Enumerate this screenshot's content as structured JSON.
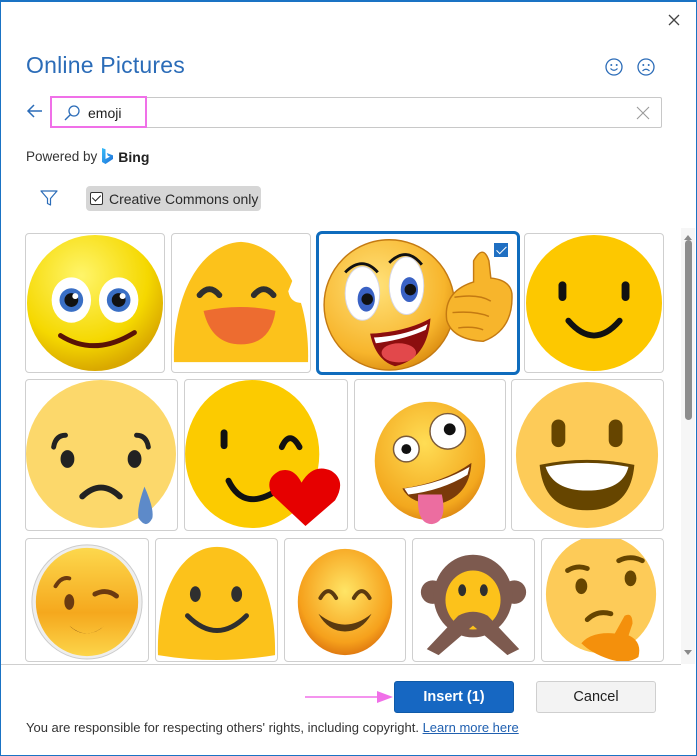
{
  "dialog": {
    "title": "Online Pictures",
    "close_icon": "close-icon",
    "feedback": {
      "smile_icon": "smile-icon",
      "frown_icon": "frown-icon"
    }
  },
  "search": {
    "back_icon": "arrow-left-icon",
    "search_icon": "search-icon",
    "value": "emoji",
    "clear_icon": "close-icon"
  },
  "powered_by": {
    "label": "Powered by",
    "brand": "Bing",
    "brand_icon": "bing-logo-icon"
  },
  "filters": {
    "filter_icon": "filter-icon",
    "creative_commons": {
      "label": "Creative Commons only",
      "checked": true
    }
  },
  "results": [
    {
      "name": "smiley-blue-eyes",
      "selected": false
    },
    {
      "name": "grinning-sweat-blob",
      "selected": false
    },
    {
      "name": "thumbs-up-smiley",
      "selected": true
    },
    {
      "name": "simple-smiley",
      "selected": false
    },
    {
      "name": "sad-crying-face",
      "selected": false
    },
    {
      "name": "winking-heart-face",
      "selected": false
    },
    {
      "name": "zany-face",
      "selected": false
    },
    {
      "name": "grinning-face",
      "selected": false
    },
    {
      "name": "winking-face",
      "selected": false
    },
    {
      "name": "slightly-smiling-blob",
      "selected": false
    },
    {
      "name": "smiling-eyes-blush",
      "selected": false
    },
    {
      "name": "speak-no-evil-monkey",
      "selected": false
    },
    {
      "name": "thinking-face",
      "selected": false
    }
  ],
  "colors": {
    "accent": "#1667c2",
    "title": "#2b6cb8",
    "highlight": "#f070e8"
  },
  "actions": {
    "insert_label": "Insert (1)",
    "cancel_label": "Cancel"
  },
  "footer": {
    "text": "You are responsible for respecting others' rights, including copyright.",
    "link": "Learn more here"
  }
}
